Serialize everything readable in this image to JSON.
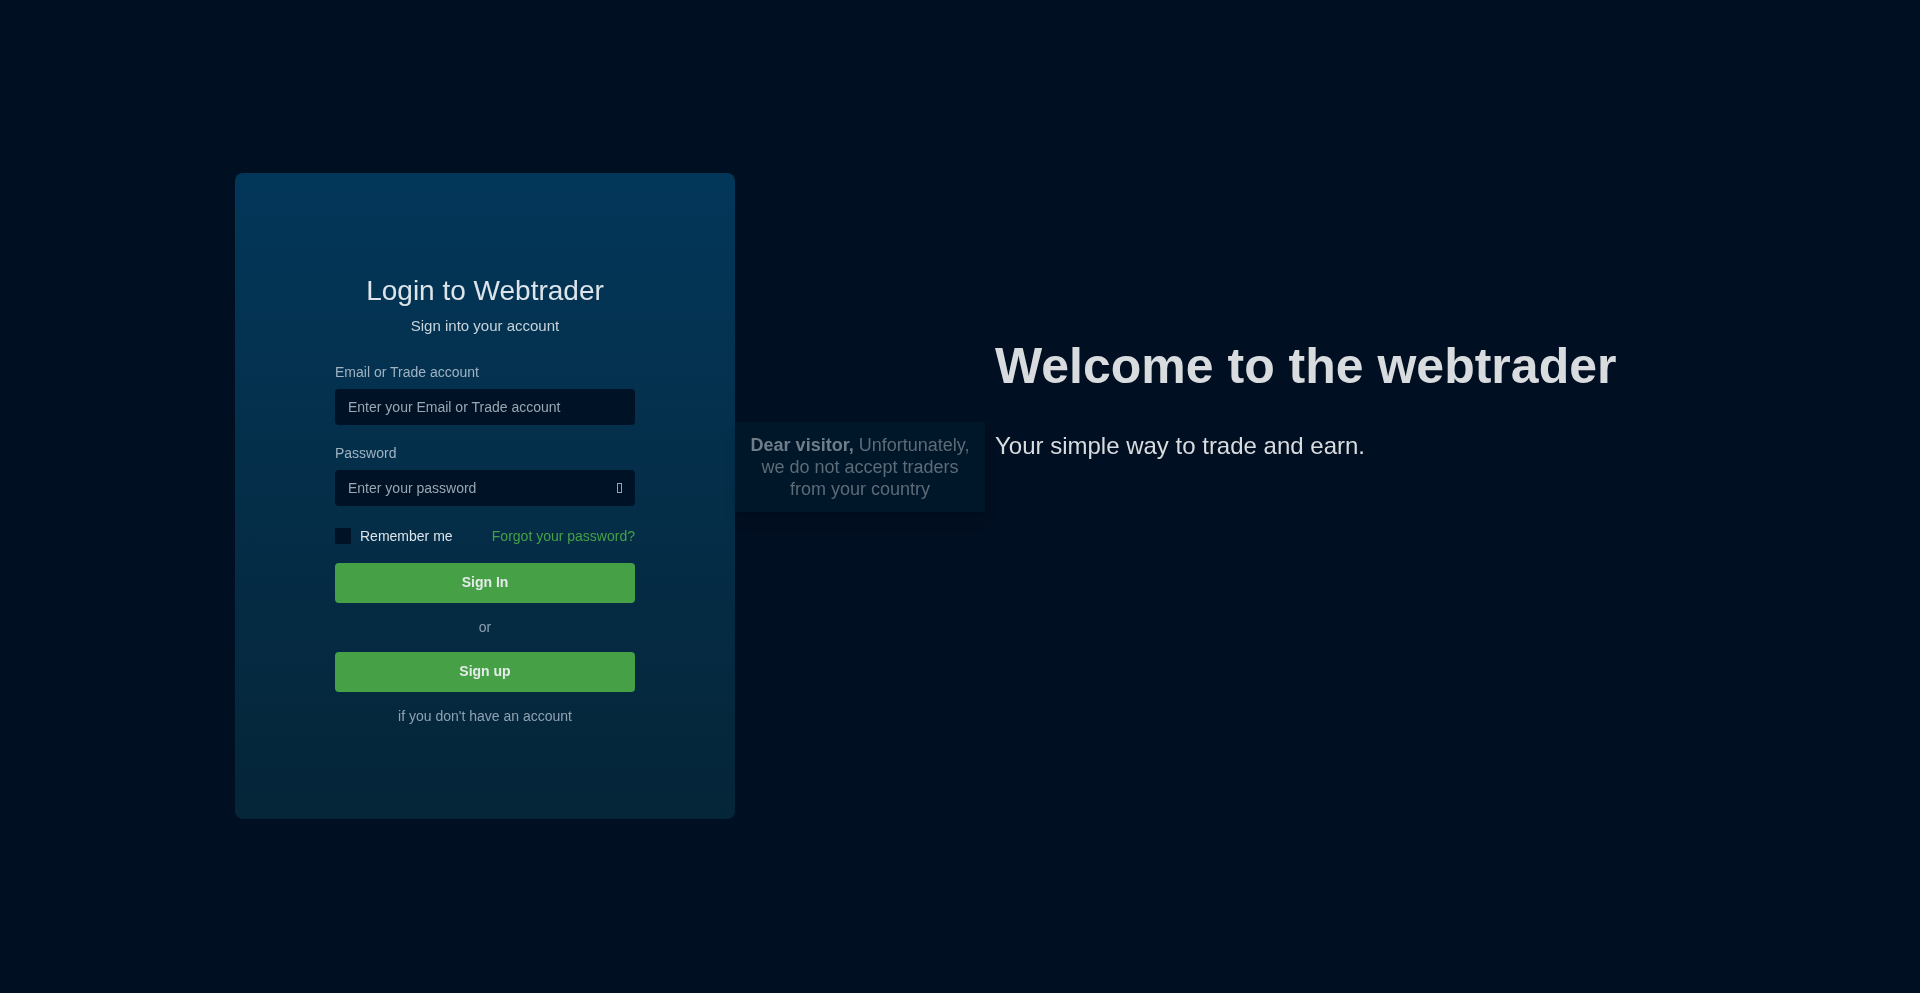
{
  "login": {
    "title": "Login to Webtrader",
    "subtitle": "Sign into your account",
    "fields": [
      {
        "label": "Email or Trade account",
        "placeholder": "Enter your Email or Trade account",
        "kind": "text"
      },
      {
        "label": "Password",
        "placeholder": "Enter your password",
        "kind": "password"
      }
    ],
    "remember_me": {
      "label": "Remember me",
      "checked": false
    },
    "forgot_link": "Forgot your password?",
    "sign_in_button": "Sign In",
    "separator": "or",
    "sign_up_button": "Sign up",
    "sign_up_hint": "if you don't have an account"
  },
  "welcome": {
    "title": "Welcome to the webtrader",
    "subtitle": "Your simple way to trade and earn."
  },
  "notice": {
    "text": "**Dear visitor,** Unfortunately, we do not accept traders from your country"
  }
}
